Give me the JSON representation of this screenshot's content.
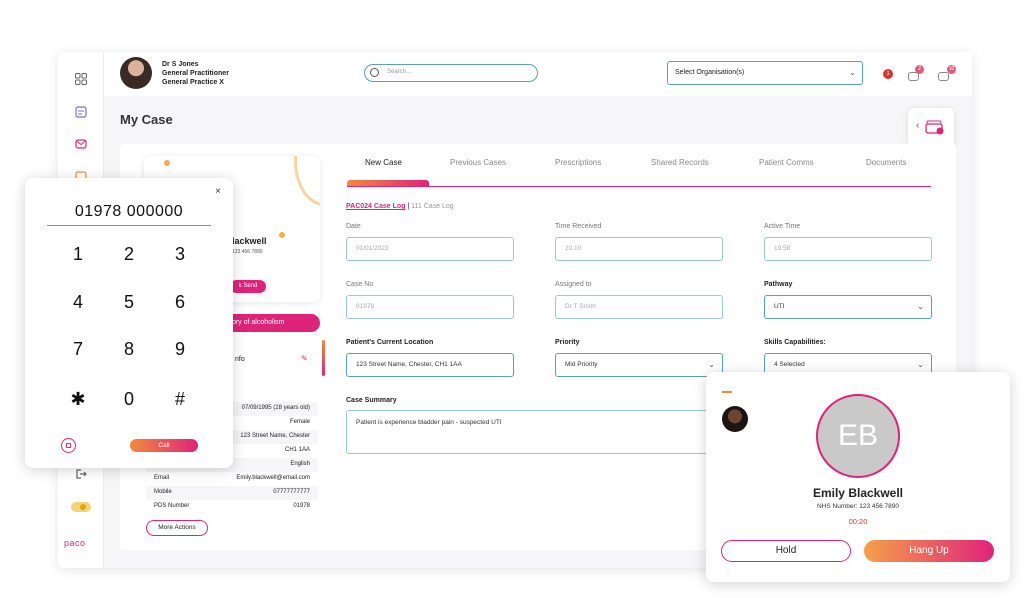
{
  "header": {
    "user_name": "Dr S Jones",
    "user_role": "General Practitioner",
    "user_practice": "General Practice X",
    "search_placeholder": "Search...",
    "org_select": "Select Organisation(s)",
    "alert_badge": "1",
    "notif_badge": "2",
    "msg_badge": "10"
  },
  "page": {
    "title": "My Case"
  },
  "patient_card": {
    "name_fragment": "lackwell",
    "nhs_fragment": "123 456 7890",
    "send_button": "k Send",
    "alert_text": "tory of alcoholism",
    "info_heading": "nfo"
  },
  "tabs": [
    "New Case",
    "Previous Cases",
    "Prescriptions",
    "Shared Records",
    "Patient Comms",
    "Documents"
  ],
  "case_log": {
    "active": "PAC024 Case Log",
    "separator": "|",
    "other": "111 Case Log"
  },
  "form": {
    "date_label": "Date",
    "date_value": "01/01/2023",
    "time_label": "Time Received",
    "time_value": "20:10",
    "active_label": "Active Time",
    "active_value": "19:58",
    "caseno_label": "Case No",
    "caseno_value": "01978",
    "assigned_label": "Assigned to",
    "assigned_value": "Dr T Smith",
    "pathway_label": "Pathway",
    "pathway_value": "UTI",
    "location_label": "Patient's Current Location",
    "location_value": "123 Street Name, Chester, CH1 1AA",
    "priority_label": "Priority",
    "priority_value": "Mid Priority",
    "skills_label": "Skills Capabilities:",
    "skills_value": "4 Selected",
    "summary_label": "Case Summary",
    "summary_value": "Patient is experience bladder pain - suspected UTI"
  },
  "patient_info": [
    {
      "k": "",
      "v": "07/09/1995 (28 years old)"
    },
    {
      "k": "",
      "v": "Female"
    },
    {
      "k": "",
      "v": "123 Street Name, Chester"
    },
    {
      "k": "",
      "v": "CH1 1AA"
    },
    {
      "k": "",
      "v": "English"
    },
    {
      "k": "Email",
      "v": "Emily.blackwell@email.com"
    },
    {
      "k": "Mobile",
      "v": "07777777777"
    },
    {
      "k": "PDS Number",
      "v": "01978"
    }
  ],
  "more_actions": "More Actions",
  "dialer": {
    "number": "01978 000000",
    "close": "×",
    "keys": [
      "1",
      "2",
      "3",
      "4",
      "5",
      "6",
      "7",
      "8",
      "9",
      "✱",
      "0",
      "#"
    ],
    "call": "Call"
  },
  "call_card": {
    "initials": "EB",
    "name": "Emily Blackwell",
    "nhs": "NHS Number: 123 456 7890",
    "timer": "00:20",
    "hold": "Hold",
    "hangup": "Hang Up"
  },
  "brand": {
    "logo": "paco"
  },
  "colors": {
    "accent": "#e0237a",
    "accent_orange": "#f28a3c",
    "field_border": "#5aa0b8"
  }
}
